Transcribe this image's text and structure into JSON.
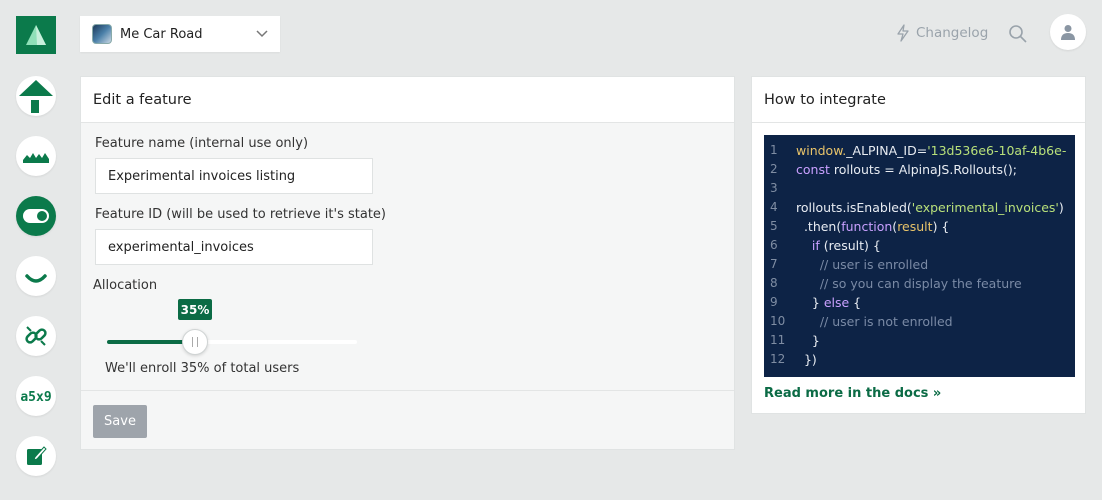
{
  "app_selector": {
    "name": "Me Car Road"
  },
  "header": {
    "changelog_label": "Changelog"
  },
  "sidebar": {
    "items": [
      {
        "icon": "home-icon"
      },
      {
        "icon": "landscape-icon"
      },
      {
        "icon": "toggle-icon",
        "active": true
      },
      {
        "icon": "smile-icon"
      },
      {
        "icon": "link-icon"
      },
      {
        "icon": "code-icon",
        "glyph": "a5x9"
      },
      {
        "icon": "edit-icon"
      }
    ]
  },
  "edit_card": {
    "title": "Edit a feature",
    "feature_name": {
      "label": "Feature name (internal use only)",
      "value": "Experimental invoices listing"
    },
    "feature_id": {
      "label": "Feature ID (will be used to retrieve it's state)",
      "value": "experimental_invoices"
    },
    "allocation": {
      "label": "Allocation",
      "value": 35,
      "badge": "35%",
      "enroll_text": "We'll enroll 35% of total users"
    },
    "save_label": "Save"
  },
  "integrate_card": {
    "title": "How to integrate",
    "docs_link": "Read more in the docs »",
    "code_lines": [
      {
        "n": "1",
        "tokens": [
          [
            "var",
            "window."
          ],
          [
            "pl",
            "_ALPINA_ID="
          ],
          [
            "str",
            "'13d536e6-10af-4b6e-"
          ]
        ]
      },
      {
        "n": "2",
        "tokens": [
          [
            "kw",
            "const "
          ],
          [
            "pl",
            "rollouts = AlpinaJS.Rollouts();"
          ]
        ]
      },
      {
        "n": "3",
        "tokens": []
      },
      {
        "n": "4",
        "tokens": [
          [
            "pl",
            "rollouts.isEnabled("
          ],
          [
            "str",
            "'experimental_invoices'"
          ],
          [
            "pl",
            ")"
          ]
        ]
      },
      {
        "n": "5",
        "tokens": [
          [
            "pl",
            "  .then("
          ],
          [
            "kw",
            "function"
          ],
          [
            "pl",
            "("
          ],
          [
            "var",
            "result"
          ],
          [
            "pl",
            ") {"
          ]
        ]
      },
      {
        "n": "6",
        "tokens": [
          [
            "pl",
            "    "
          ],
          [
            "kw",
            "if "
          ],
          [
            "pl",
            "(result) {"
          ]
        ]
      },
      {
        "n": "7",
        "tokens": [
          [
            "cm",
            "      // user is enrolled"
          ]
        ]
      },
      {
        "n": "8",
        "tokens": [
          [
            "cm",
            "      // so you can display the feature"
          ]
        ]
      },
      {
        "n": "9",
        "tokens": [
          [
            "pl",
            "    } "
          ],
          [
            "kw",
            "else "
          ],
          [
            "pl",
            "{"
          ]
        ]
      },
      {
        "n": "10",
        "tokens": [
          [
            "cm",
            "      // user is not enrolled"
          ]
        ]
      },
      {
        "n": "11",
        "tokens": [
          [
            "pl",
            "    }"
          ]
        ]
      },
      {
        "n": "12",
        "tokens": [
          [
            "pl",
            "  })"
          ]
        ]
      }
    ]
  },
  "colors": {
    "brand": "#0b7a4b",
    "accent": "#0b6b45",
    "code_bg": "#0d2346",
    "save_disabled": "#9ea4ab"
  }
}
